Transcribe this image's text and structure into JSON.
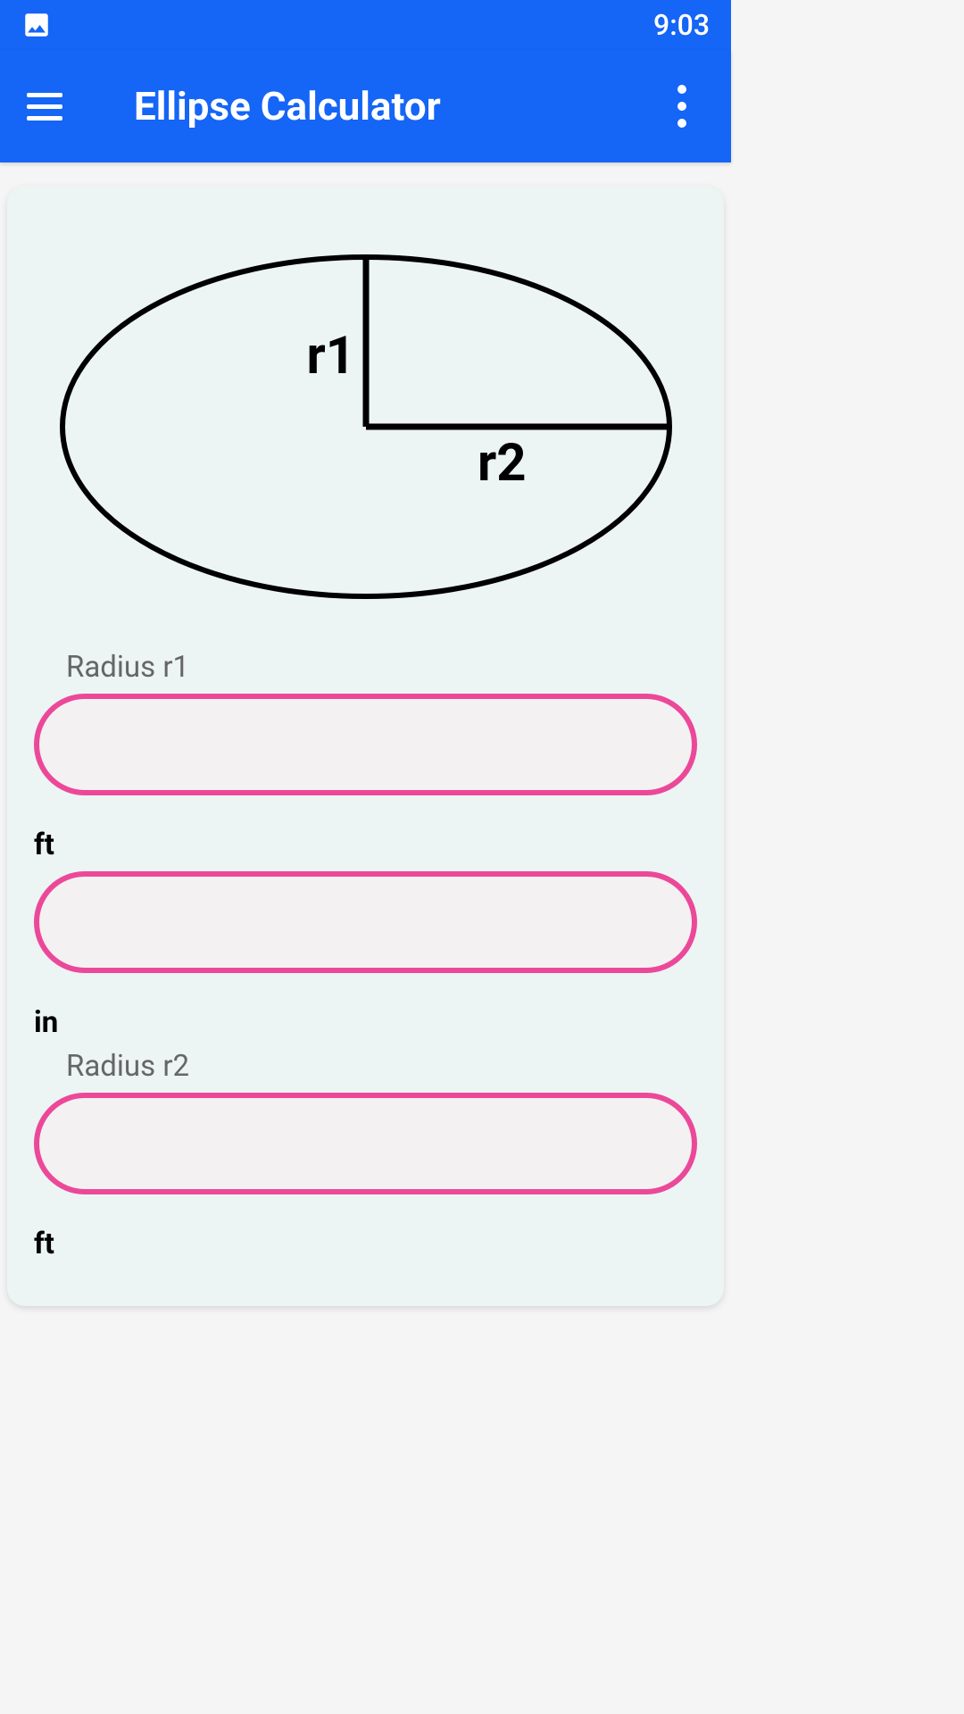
{
  "status": {
    "time": "9:03"
  },
  "header": {
    "title": "Ellipse Calculator"
  },
  "diagram": {
    "r1_label": "r1",
    "r2_label": "r2"
  },
  "form": {
    "radius_r1_label": "Radius r1",
    "radius_r2_label": "Radius r2",
    "unit_ft": "ft",
    "unit_in": "in",
    "radius_r1_value": "",
    "ft_value": "",
    "radius_r2_value": ""
  }
}
